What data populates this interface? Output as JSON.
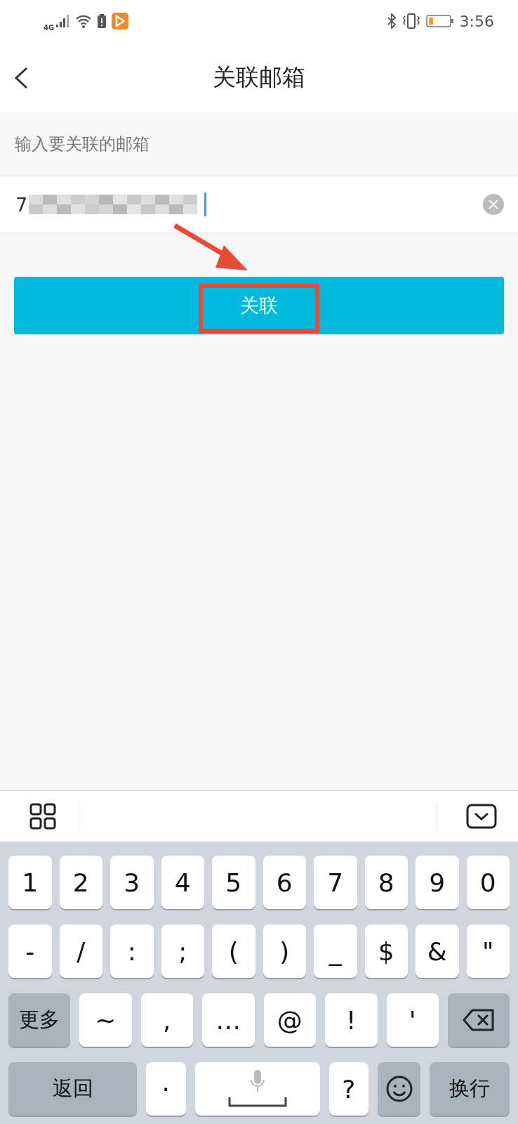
{
  "status_bar": {
    "network": "4G",
    "time": "3:56"
  },
  "header": {
    "title": "关联邮箱"
  },
  "form": {
    "label": "输入要关联的邮箱",
    "email": {
      "value": "7",
      "redacted": true
    },
    "button": "关联"
  },
  "annotations": [
    {
      "kind": "arrow"
    },
    {
      "kind": "frame"
    }
  ],
  "keyboard": {
    "rows": [
      {
        "keys": [
          {
            "kind": "char",
            "label": "1"
          },
          {
            "kind": "char",
            "label": "2"
          },
          {
            "kind": "char",
            "label": "3"
          },
          {
            "kind": "char",
            "label": "4"
          },
          {
            "kind": "char",
            "label": "5"
          },
          {
            "kind": "char",
            "label": "6"
          },
          {
            "kind": "char",
            "label": "7"
          },
          {
            "kind": "char",
            "label": "8"
          },
          {
            "kind": "char",
            "label": "9"
          },
          {
            "kind": "char",
            "label": "0"
          }
        ]
      },
      {
        "keys": [
          {
            "kind": "char",
            "label": "-"
          },
          {
            "kind": "char",
            "label": "/"
          },
          {
            "kind": "char",
            "label": ":"
          },
          {
            "kind": "char",
            "label": ";"
          },
          {
            "kind": "char",
            "label": "("
          },
          {
            "kind": "char",
            "label": ")"
          },
          {
            "kind": "char",
            "label": "_"
          },
          {
            "kind": "char",
            "label": "$"
          },
          {
            "kind": "char",
            "label": "&"
          },
          {
            "kind": "char",
            "label": "\""
          }
        ]
      },
      {
        "keys": [
          {
            "kind": "more",
            "label": "更多"
          },
          {
            "kind": "char",
            "label": "~"
          },
          {
            "kind": "char",
            "label": ","
          },
          {
            "kind": "char",
            "label": "…"
          },
          {
            "kind": "char",
            "label": "@"
          },
          {
            "kind": "char",
            "label": "!"
          },
          {
            "kind": "char",
            "label": "'"
          },
          {
            "kind": "delete"
          }
        ]
      },
      {
        "keys": [
          {
            "kind": "back",
            "label": "返回"
          },
          {
            "kind": "char",
            "label": "·"
          },
          {
            "kind": "space"
          },
          {
            "kind": "char",
            "label": "?"
          },
          {
            "kind": "emoji"
          },
          {
            "kind": "enter",
            "label": "换行"
          }
        ]
      }
    ]
  }
}
